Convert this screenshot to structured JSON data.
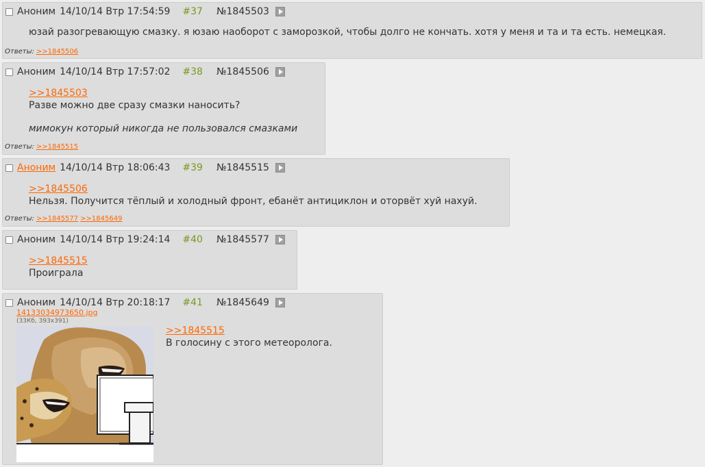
{
  "replies_label": "Ответы:",
  "posts": [
    {
      "name": "Аноним",
      "date": "14/10/14 Втр 17:54:59",
      "num": "#37",
      "id": "№1845503",
      "text": "юзай разогревающую смазку. я юзаю наоборот с заморозкой, чтобы долго не кончать. хотя у меня и та и та есть. немецкая.",
      "replies": [
        ">>1845506"
      ]
    },
    {
      "name": "Аноним",
      "date": "14/10/14 Втр 17:57:02",
      "num": "#38",
      "id": "№1845506",
      "reply_to": ">>1845503",
      "text": "Разве можно две сразу смазки наносить?",
      "italic_text": "мимокун который никогда не пользовался смазками",
      "replies": [
        ">>1845515"
      ]
    },
    {
      "name": "Аноним",
      "date": "14/10/14 Втр 18:06:43",
      "num": "#39",
      "id": "№1845515",
      "reply_to": ">>1845506",
      "text": "Нельзя. Получится тёплый и холодный фронт, ебанёт антициклон и оторвёт хуй нахуй.",
      "replies": [
        ">>1845577",
        ">>1845649"
      ]
    },
    {
      "name": "Аноним",
      "date": "14/10/14 Втр 19:24:14",
      "num": "#40",
      "id": "№1845577",
      "reply_to": ">>1845515",
      "text": "Проиграла"
    },
    {
      "name": "Аноним",
      "date": "14/10/14 Втр 20:18:17",
      "num": "#41",
      "id": "№1845649",
      "file_name": "14133034973650.jpg",
      "file_meta": "(33Кб, 393x391)",
      "reply_to": ">>1845515",
      "text": "В голосину с этого метеоролога."
    }
  ],
  "colors": {
    "background": "#eeeeee",
    "post_bg": "#dddddd",
    "link": "#ff6600",
    "post_number": "#789922"
  }
}
